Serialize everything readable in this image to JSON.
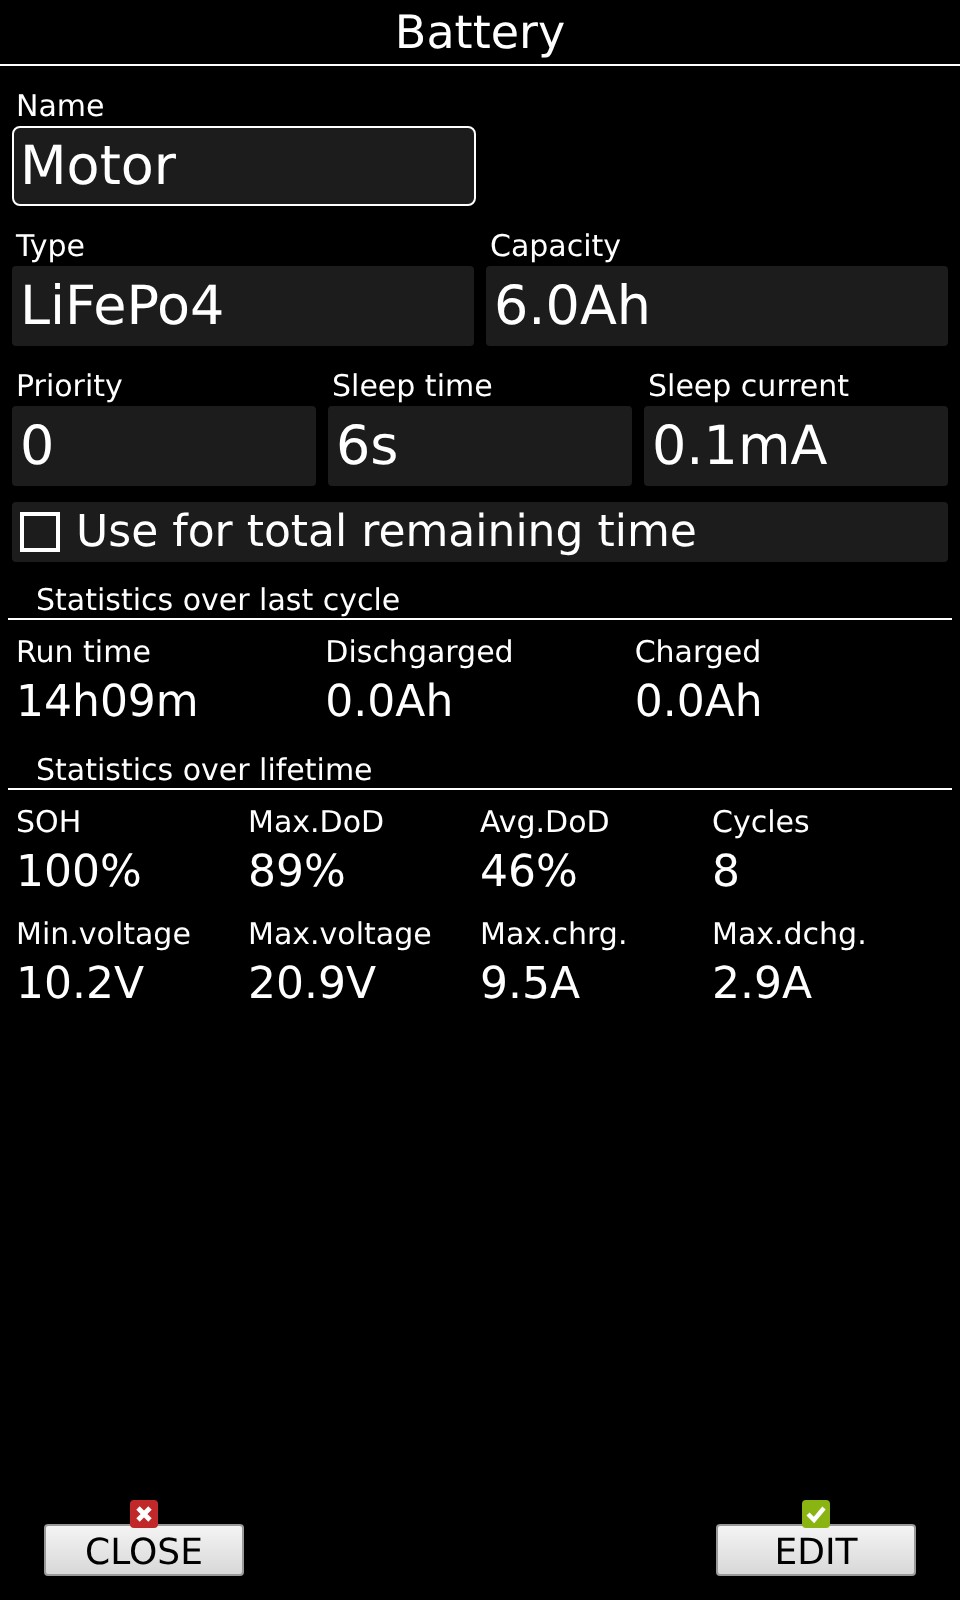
{
  "window": {
    "title": "Battery"
  },
  "field_rows": [
    [
      {
        "label": "Name",
        "value": "Motor",
        "selected": true
      }
    ],
    [
      {
        "label": "Type",
        "value": "LiFePo4",
        "selected": false
      },
      {
        "label": "Capacity",
        "value": "6.0Ah",
        "selected": false
      }
    ],
    [
      {
        "label": "Priority",
        "value": "0",
        "selected": false
      },
      {
        "label": "Sleep time",
        "value": "6s",
        "selected": false
      },
      {
        "label": "Sleep current",
        "value": "0.1mA",
        "selected": false
      }
    ]
  ],
  "option": {
    "label": "Use for total remaining time",
    "checked": false
  },
  "sections": [
    {
      "title": "Statistics over last cycle",
      "rows": [
        [
          {
            "label": "Run time",
            "value": "14h09m"
          },
          {
            "label": "Dischgarged",
            "value": "0.0Ah"
          },
          {
            "label": "Charged",
            "value": "0.0Ah"
          }
        ]
      ]
    },
    {
      "title": "Statistics over lifetime",
      "rows": [
        [
          {
            "label": "SOH",
            "value": "100%"
          },
          {
            "label": "Max.DoD",
            "value": "89%"
          },
          {
            "label": "Avg.DoD",
            "value": "46%"
          },
          {
            "label": "Cycles",
            "value": "8"
          }
        ],
        [
          {
            "label": "Min.voltage",
            "value": "10.2V"
          },
          {
            "label": "Max.voltage",
            "value": "20.9V"
          },
          {
            "label": "Max.chrg.",
            "value": "9.5A"
          },
          {
            "label": "Max.dchg.",
            "value": "2.9A"
          }
        ]
      ]
    }
  ],
  "buttons": [
    {
      "label": "CLOSE",
      "kind": "cancel"
    },
    {
      "label": "EDIT",
      "kind": "confirm"
    }
  ]
}
